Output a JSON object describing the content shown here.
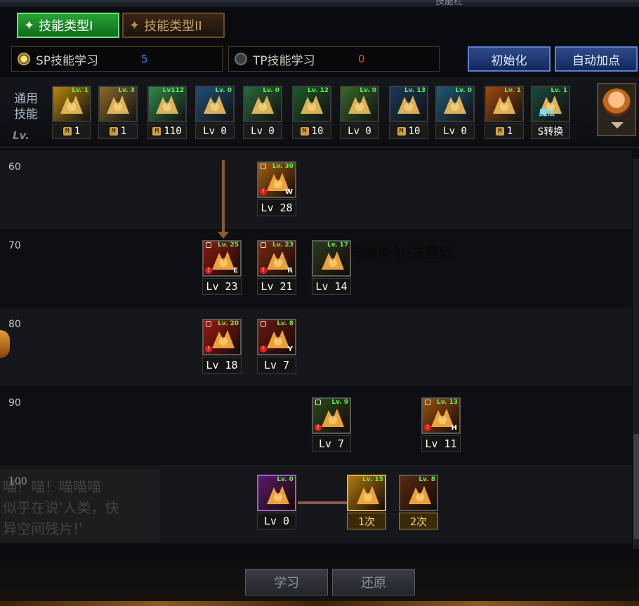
{
  "header": {
    "title_hint": "技能栏"
  },
  "tabs": [
    {
      "label": "技能类型I",
      "active": true
    },
    {
      "label": "技能类型II",
      "active": false
    }
  ],
  "points": {
    "sp": {
      "label": "SP技能学习",
      "value": "5",
      "selected": true
    },
    "tp": {
      "label": "TP技能学习",
      "value": "0",
      "selected": false
    }
  },
  "buttons": {
    "init": "初始化",
    "auto": "自动加点",
    "learn": "学习",
    "revert": "还原"
  },
  "common": {
    "label_line1": "通用",
    "label_line2": "技能",
    "lv_label": "Lv.",
    "skills": [
      {
        "tag": "Lv. 1",
        "bottom": "1",
        "mastered": true,
        "color": "#b8860b",
        "icon": "kick-icon"
      },
      {
        "tag": "Lv. 3",
        "bottom": "1",
        "mastered": true,
        "color": "#8a6a2a",
        "icon": "crouch-icon"
      },
      {
        "tag": "Lv112",
        "bottom": "110",
        "mastered": true,
        "color": "#2e8a4a",
        "icon": "dash-icon"
      },
      {
        "tag": "Lv. 0",
        "bottom": "Lv 0",
        "mastered": false,
        "color": "#1f4f7a",
        "icon": "wings-icon"
      },
      {
        "tag": "Lv. 0",
        "bottom": "Lv 0",
        "mastered": false,
        "color": "#2a6a3a",
        "icon": "leap-icon"
      },
      {
        "tag": "Lv. 12",
        "bottom": "10",
        "mastered": true,
        "color": "#1c5a2a",
        "icon": "target-icon"
      },
      {
        "tag": "Lv. 0",
        "bottom": "Lv 0",
        "mastered": false,
        "color": "#3a6a2a",
        "icon": "tumble-icon"
      },
      {
        "tag": "Lv. 13",
        "bottom": "10",
        "mastered": true,
        "color": "#1a3a5a",
        "icon": "eye-shield-icon"
      },
      {
        "tag": "Lv. 0",
        "bottom": "Lv 0",
        "mastered": false,
        "color": "#1e5a7a",
        "icon": "body-icon"
      },
      {
        "tag": "Lv. 1",
        "bottom": "1",
        "mastered": true,
        "color": "#a04a10",
        "icon": "burst-icon"
      },
      {
        "tag": "Lv. 1",
        "bottom": "S转换",
        "mastered": false,
        "color": "#1a4a3a",
        "icon": "magic-swap-icon",
        "overlay": "魔法"
      }
    ]
  },
  "levels": [
    "60",
    "70",
    "80",
    "90",
    "100"
  ],
  "tree_skills": [
    {
      "id": "s60",
      "tag": "Lv. 30",
      "bottom": "Lv 28",
      "letter": "W",
      "color": "#a06010",
      "locked": true
    },
    {
      "id": "s70a",
      "tag": "Lv. 25",
      "bottom": "Lv 23",
      "letter": "E",
      "color": "#8a1a10",
      "locked": true
    },
    {
      "id": "s70b",
      "tag": "Lv. 23",
      "bottom": "Lv 21",
      "letter": "R",
      "color": "#7a2a10",
      "locked": true
    },
    {
      "id": "s70c",
      "tag": "Lv. 17",
      "bottom": "Lv 14",
      "letter": "",
      "color": "#2a3a20",
      "locked": false
    },
    {
      "id": "s80a",
      "tag": "Lv. 20",
      "bottom": "Lv 18",
      "letter": "",
      "color": "#9a1a10",
      "locked": true
    },
    {
      "id": "s80b",
      "tag": "Lv. 8",
      "bottom": "Lv 7",
      "letter": "Y",
      "color": "#6a1a10",
      "locked": true
    },
    {
      "id": "s90a",
      "tag": "Lv. 9",
      "bottom": "Lv 7",
      "letter": "",
      "color": "#2a4a1a",
      "locked": true
    },
    {
      "id": "s90b",
      "tag": "Lv. 13",
      "bottom": "Lv 11",
      "letter": "H",
      "color": "#9a5010",
      "locked": true
    },
    {
      "id": "s100a",
      "tag": "Lv. 0",
      "bottom": "Lv 0",
      "letter": "",
      "color": "#5a1a6a",
      "locked": false
    },
    {
      "id": "s100b",
      "tag": "Lv. 15",
      "bottom": "1次",
      "letter": "",
      "color": "#b07a10",
      "locked": false
    },
    {
      "id": "s100c",
      "tag": "Lv. 8",
      "bottom": "2次",
      "letter": "",
      "color": "#5a2a10",
      "locked": false
    }
  ],
  "background": {
    "character_name": "赛联森与姆斯尔·东里欧",
    "chat": "喵！喵！喵喵喵\n似乎在说'人类，快\n异空间残片!'"
  },
  "colors": {
    "sp_value": "#3d8bff",
    "tp_value": "#ff4a1c",
    "level_tag": "#5ff25a",
    "tab_active": "#29a335"
  }
}
